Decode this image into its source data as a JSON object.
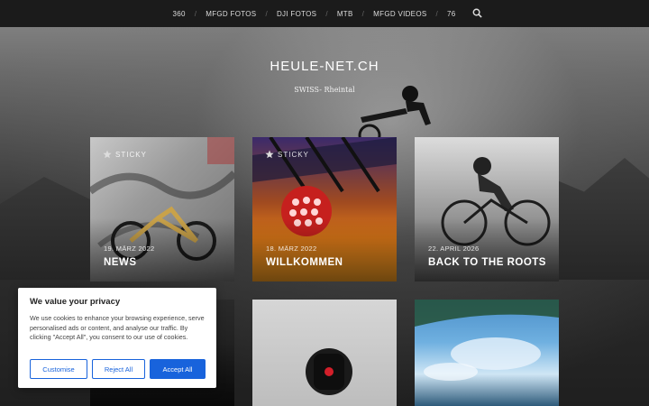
{
  "nav": {
    "items": [
      "360",
      "MFGD FOTOS",
      "DJI FOTOS",
      "MTB",
      "MFGD VIDEOS",
      "76"
    ],
    "separator": "/",
    "search_icon": "search-icon"
  },
  "site": {
    "title": "HEULE-NET.CH",
    "description": "SWISS- Rheintal"
  },
  "posts": [
    {
      "sticky": "STICKY",
      "date": "19. März 2022",
      "title": "NEWS"
    },
    {
      "sticky": "STICKY",
      "date": "18. März 2022",
      "title": "WILLKOMMEN"
    },
    {
      "date": "22. April 2026",
      "title": "BACK TO THE ROOTS"
    }
  ],
  "cookie": {
    "title": "We value your privacy",
    "text": "We use cookies to enhance your browsing experience, serve personalised ads or content, and analyse our traffic. By clicking \"Accept All\", you consent to our use of cookies.",
    "customise_label": "Customise",
    "reject_label": "Reject All",
    "accept_label": "Accept All"
  },
  "colors": {
    "accent": "#1863dc",
    "nav_bg": "#1b1b1b"
  }
}
